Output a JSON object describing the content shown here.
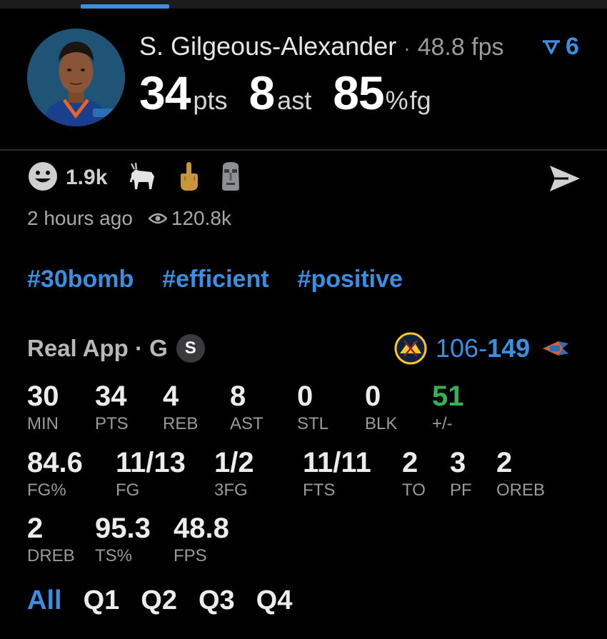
{
  "player": {
    "name": "S. Gilgeous-Alexander",
    "separator": "·",
    "fps_text": "48.8 fps",
    "badge_count": "6"
  },
  "headline": [
    {
      "value": "34",
      "unit": "pts"
    },
    {
      "value": "8",
      "unit": "ast"
    },
    {
      "value": "85",
      "unit_pct": "%",
      "unit": "fg"
    }
  ],
  "reactions": {
    "count": "1.9k",
    "icons": [
      "smile-icon",
      "goat-icon",
      "middle-finger-icon",
      "moai-icon"
    ]
  },
  "meta": {
    "time": "2 hours ago",
    "views": "120.8k"
  },
  "hashtags": [
    "#30bomb",
    "#efficient",
    "#positive"
  ],
  "source": {
    "label": "Real App · G",
    "badge": "S"
  },
  "game": {
    "score_loss": "106",
    "dash": "-",
    "score_win": "149"
  },
  "stats": [
    {
      "value": "30",
      "label": "MIN"
    },
    {
      "value": "34",
      "label": "PTS"
    },
    {
      "value": "4",
      "label": "REB"
    },
    {
      "value": "8",
      "label": "AST"
    },
    {
      "value": "0",
      "label": "STL"
    },
    {
      "value": "0",
      "label": "BLK"
    },
    {
      "value": "51",
      "label": "+/-"
    },
    {
      "value": "84.6",
      "label": "FG%"
    },
    {
      "value": "11/13",
      "label": "FG"
    },
    {
      "value": "1/2",
      "label": "3FG"
    },
    {
      "value": "11/11",
      "label": "FTS"
    },
    {
      "value": "2",
      "label": "TO"
    },
    {
      "value": "3",
      "label": "PF"
    },
    {
      "value": "2",
      "label": "OREB"
    },
    {
      "value": "2",
      "label": "DREB"
    },
    {
      "value": "95.3",
      "label": "TS%"
    },
    {
      "value": "48.8",
      "label": "FPS"
    }
  ],
  "periods": [
    "All",
    "Q1",
    "Q2",
    "Q3",
    "Q4"
  ],
  "colors": {
    "accent": "#3a8fe0",
    "positive": "#35b15a",
    "background": "#000000"
  }
}
